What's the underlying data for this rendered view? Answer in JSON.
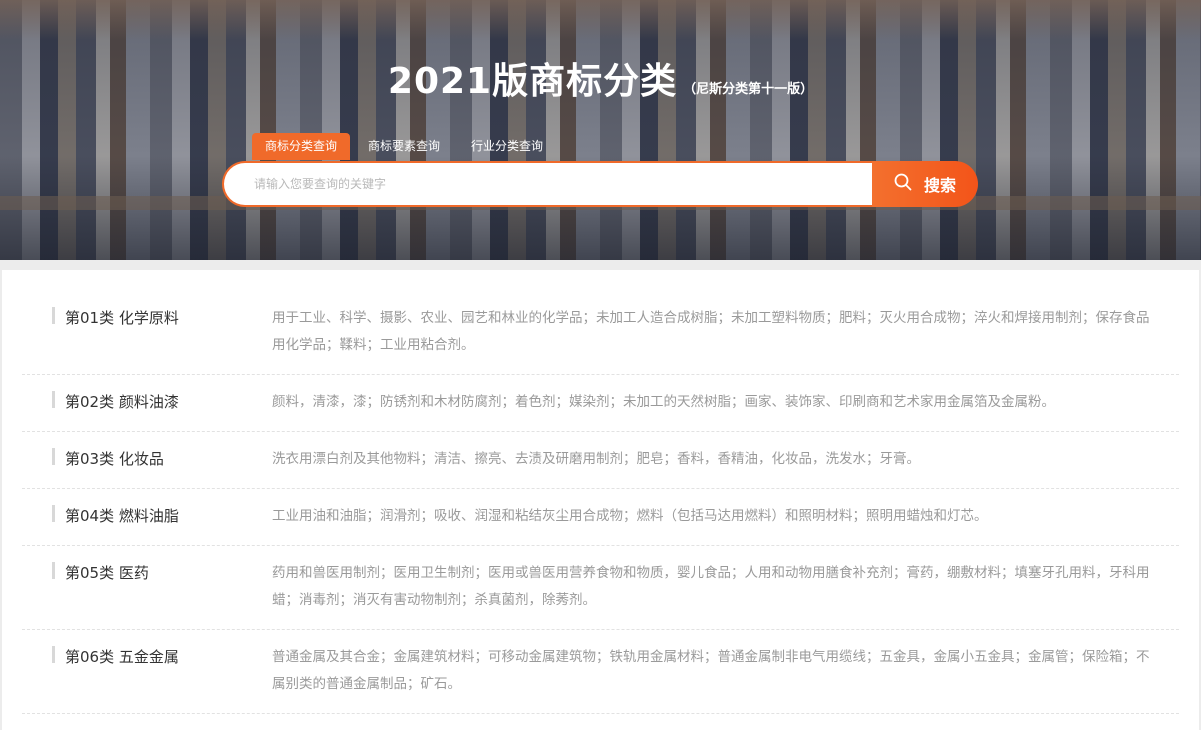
{
  "hero": {
    "title": "2021版商标分类",
    "subtitle": "（尼斯分类第十一版）"
  },
  "tabs": [
    {
      "label": "商标分类查询",
      "active": true
    },
    {
      "label": "商标要素查询",
      "active": false
    },
    {
      "label": "行业分类查询",
      "active": false
    }
  ],
  "search": {
    "placeholder": "请输入您要查询的关键字",
    "button_label": "搜索",
    "icon": "search-icon"
  },
  "colors": {
    "accent": "#f06a2a",
    "text_dark": "#333333",
    "text_muted": "#9a9a9a"
  },
  "categories": [
    {
      "name": "第01类 化学原料",
      "desc": "用于工业、科学、摄影、农业、园艺和林业的化学品；未加工人造合成树脂；未加工塑料物质；肥料；灭火用合成物；淬火和焊接用制剂；保存食品用化学品；鞣料；工业用粘合剂。"
    },
    {
      "name": "第02类 颜料油漆",
      "desc": "颜料，清漆，漆；防锈剂和木材防腐剂；着色剂；媒染剂；未加工的天然树脂；画家、装饰家、印刷商和艺术家用金属箔及金属粉。"
    },
    {
      "name": "第03类 化妆品",
      "desc": "洗衣用漂白剂及其他物料；清洁、擦亮、去渍及研磨用制剂；肥皂；香料，香精油，化妆品，洗发水；牙膏。"
    },
    {
      "name": "第04类 燃料油脂",
      "desc": "工业用油和油脂；润滑剂；吸收、润湿和粘结灰尘用合成物；燃料（包括马达用燃料）和照明材料；照明用蜡烛和灯芯。"
    },
    {
      "name": "第05类 医药",
      "desc": "药用和兽医用制剂；医用卫生制剂；医用或兽医用营养食物和物质，婴儿食品；人用和动物用膳食补充剂；膏药，绷敷材料；填塞牙孔用料，牙科用蜡；消毒剂；消灭有害动物制剂；杀真菌剂，除莠剂。"
    },
    {
      "name": "第06类 五金金属",
      "desc": "普通金属及其合金；金属建筑材料；可移动金属建筑物；铁轨用金属材料；普通金属制非电气用缆线；五金具，金属小五金具；金属管；保险箱；不属别类的普通金属制品；矿石。"
    }
  ]
}
